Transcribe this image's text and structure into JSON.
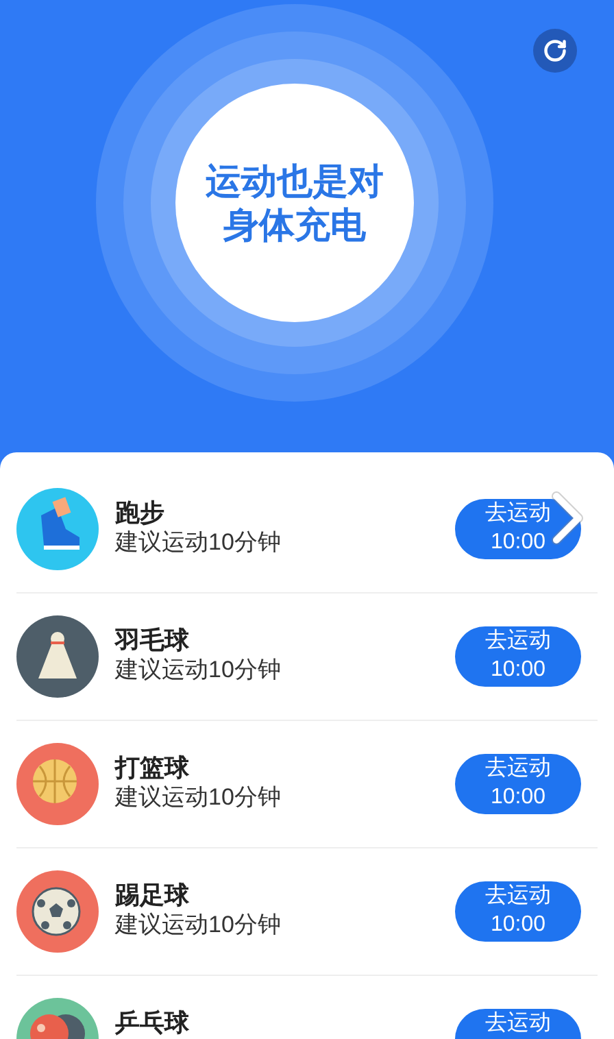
{
  "header": {
    "slogan_lines": [
      "运动也是对",
      "身体充电"
    ]
  },
  "sports": [
    {
      "kind": "running",
      "name": "跑步",
      "hint": "建议运动10分钟",
      "button": {
        "label": "去运动",
        "time": "10:00"
      }
    },
    {
      "kind": "badminton",
      "name": "羽毛球",
      "hint": "建议运动10分钟",
      "button": {
        "label": "去运动",
        "time": "10:00"
      }
    },
    {
      "kind": "basketball",
      "name": "打篮球",
      "hint": "建议运动10分钟",
      "button": {
        "label": "去运动",
        "time": "10:00"
      }
    },
    {
      "kind": "soccer",
      "name": "踢足球",
      "hint": "建议运动10分钟",
      "button": {
        "label": "去运动",
        "time": "10:00"
      }
    },
    {
      "kind": "pingpong",
      "name": "乒乓球",
      "button": {
        "label": "去运动"
      }
    }
  ]
}
